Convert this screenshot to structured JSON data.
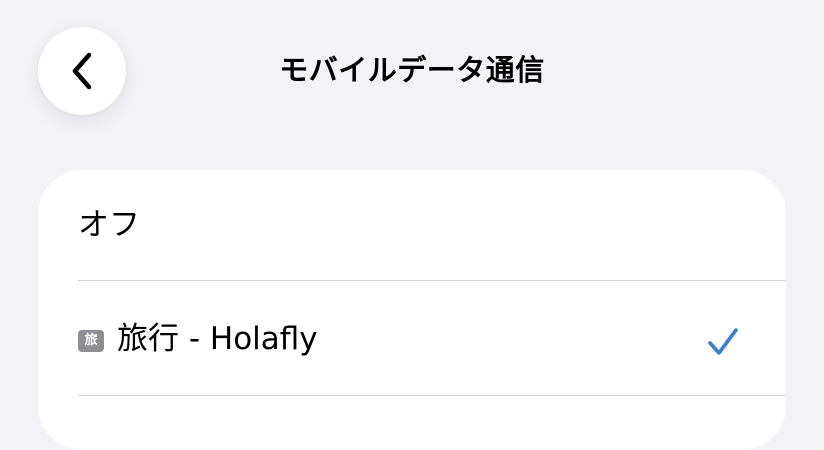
{
  "header": {
    "title": "モバイルデータ通信",
    "back_icon": "chevron-left-icon"
  },
  "options": [
    {
      "label": "オフ",
      "selected": false
    },
    {
      "label": "旅行 - Holafly",
      "badge": "旅",
      "selected": true,
      "check_icon": "checkmark-icon"
    }
  ],
  "colors": {
    "background": "#F2F2F7",
    "card": "#FFFFFF",
    "accent": "#3A80D2",
    "badge": "#8E8E93"
  }
}
